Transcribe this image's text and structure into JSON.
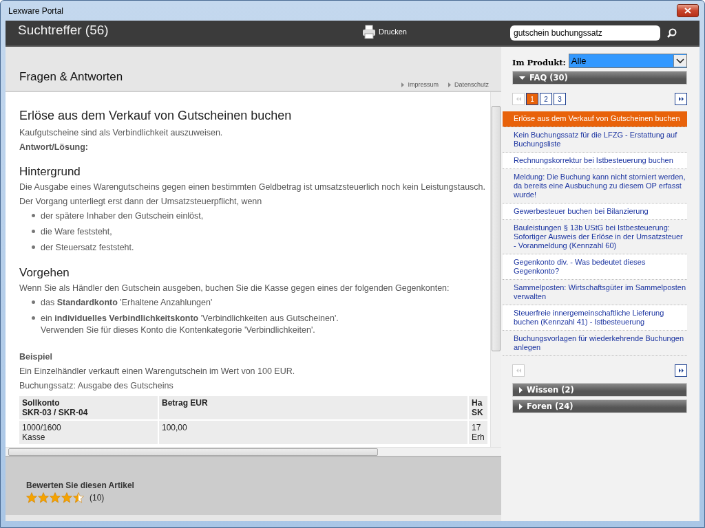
{
  "window": {
    "title": "Lexware Portal"
  },
  "header": {
    "title": "Suchtreffer (56)",
    "print_label": "Drucken",
    "search": {
      "value": "gutschein buchungssatz"
    }
  },
  "page": {
    "title": "Fragen & Antworten",
    "links": [
      "Impressum",
      "Datenschutz"
    ]
  },
  "article": {
    "title": "Erlöse aus dem Verkauf von Gutscheinen buchen",
    "blocks": [
      {
        "kind": "text",
        "text": "Kaufgutscheine sind als Verbindlichkeit auszuweisen."
      },
      {
        "kind": "label",
        "text": "Antwort/Lösung:"
      },
      {
        "kind": "heading",
        "text": "Hintergrund"
      },
      {
        "kind": "text",
        "text": "Die Ausgabe eines Warengutscheins gegen einen bestimmten Geldbetrag ist umsatzsteuerlich noch kein Leistungstausch."
      },
      {
        "kind": "text",
        "text": "Der Vorgang unterliegt erst dann der Umsatzsteuerpflicht, wenn"
      },
      {
        "kind": "bullets",
        "items": [
          {
            "text": "der spätere Inhaber den Gutschein einlöst,"
          },
          {
            "text": "die Ware feststeht,"
          },
          {
            "text": "der Steuersatz feststeht."
          }
        ]
      },
      {
        "kind": "heading",
        "text": "Vorgehen"
      },
      {
        "kind": "text",
        "text": "Wenn Sie als Händler den Gutschein ausgeben, buchen Sie die Kasse gegen eines der folgenden Gegenkonten:"
      },
      {
        "kind": "bullets",
        "items": [
          {
            "text": "das **Standardkonto** 'Erhaltene Anzahlungen'"
          },
          {
            "text": "ein **individuelles Verbindlichkeitskonto** 'Verbindlichkeiten aus Gutscheinen'.",
            "note": "Verwenden Sie für dieses Konto die Kontenkategorie 'Verbindlichkeiten'."
          }
        ]
      },
      {
        "kind": "label",
        "text": "Beispiel"
      },
      {
        "kind": "text",
        "text": "Ein Einzelhändler verkauft einen Warengutschein im Wert von 100 EUR."
      },
      {
        "kind": "text",
        "text": "Buchungssatz: Ausgabe des Gutscheins"
      },
      {
        "kind": "table",
        "columns": [
          {
            "lines": [
              "Sollkonto",
              "SKR-03 / SKR-04"
            ]
          },
          {
            "lines": [
              "Betrag EUR"
            ]
          },
          {
            "lines": [
              "Ha",
              "SK"
            ]
          }
        ],
        "rows": [
          [
            {
              "lines": [
                "1000/1600",
                "Kasse"
              ]
            },
            {
              "lines": [
                "100,00"
              ]
            },
            {
              "lines": [
                "17",
                "Erh"
              ]
            }
          ]
        ]
      }
    ]
  },
  "rating": {
    "label": "Bewerten Sie diesen Artikel",
    "stars": 4.5,
    "count": "(10)"
  },
  "sidebar": {
    "filter_label": "Im Produkt:",
    "filter_value": "Alle",
    "sections": [
      {
        "title": "FAQ (30)",
        "expanded": true,
        "pager": {
          "first_disabled": true,
          "next_disabled": false,
          "pages": [
            {
              "label": "1",
              "selected": true
            },
            {
              "label": "2",
              "selected": false
            },
            {
              "label": "3",
              "selected": false
            }
          ]
        },
        "items": [
          {
            "text": "Erlöse aus dem Verkauf von Gutscheinen buchen",
            "selected": true
          },
          {
            "text": "Kein Buchungssatz für die LFZG - Erstattung auf Buchungsliste",
            "selected": false
          },
          {
            "text": "Rechnungskorrektur bei Istbesteuerung buchen",
            "selected": false
          },
          {
            "text": "Meldung: Die Buchung kann nicht storniert werden, da bereits eine Ausbuchung zu diesem OP erfasst wurde!",
            "selected": false
          },
          {
            "text": "Gewerbesteuer buchen bei Bilanzierung",
            "selected": false
          },
          {
            "text": "Bauleistungen § 13b UStG bei Istbesteuerung: Sofortiger Ausweis der Erlöse in der Umsatzsteuer - Voranmeldung (Kennzahl 60)",
            "selected": false
          },
          {
            "text": "Gegenkonto div. - Was bedeutet dieses Gegenkonto?",
            "selected": false
          },
          {
            "text": "Sammelposten: Wirtschaftsgüter im Sammelposten verwalten",
            "selected": false
          },
          {
            "text": "Steuerfreie innergemeinschaftliche Lieferung buchen (Kennzahl 41) - Istbesteuerung",
            "selected": false
          },
          {
            "text": "Buchungsvorlagen für wiederkehrende Buchungen anlegen",
            "selected": false
          }
        ]
      },
      {
        "title": "Wissen (2)",
        "expanded": false
      },
      {
        "title": "Foren (24)",
        "expanded": false
      }
    ]
  }
}
